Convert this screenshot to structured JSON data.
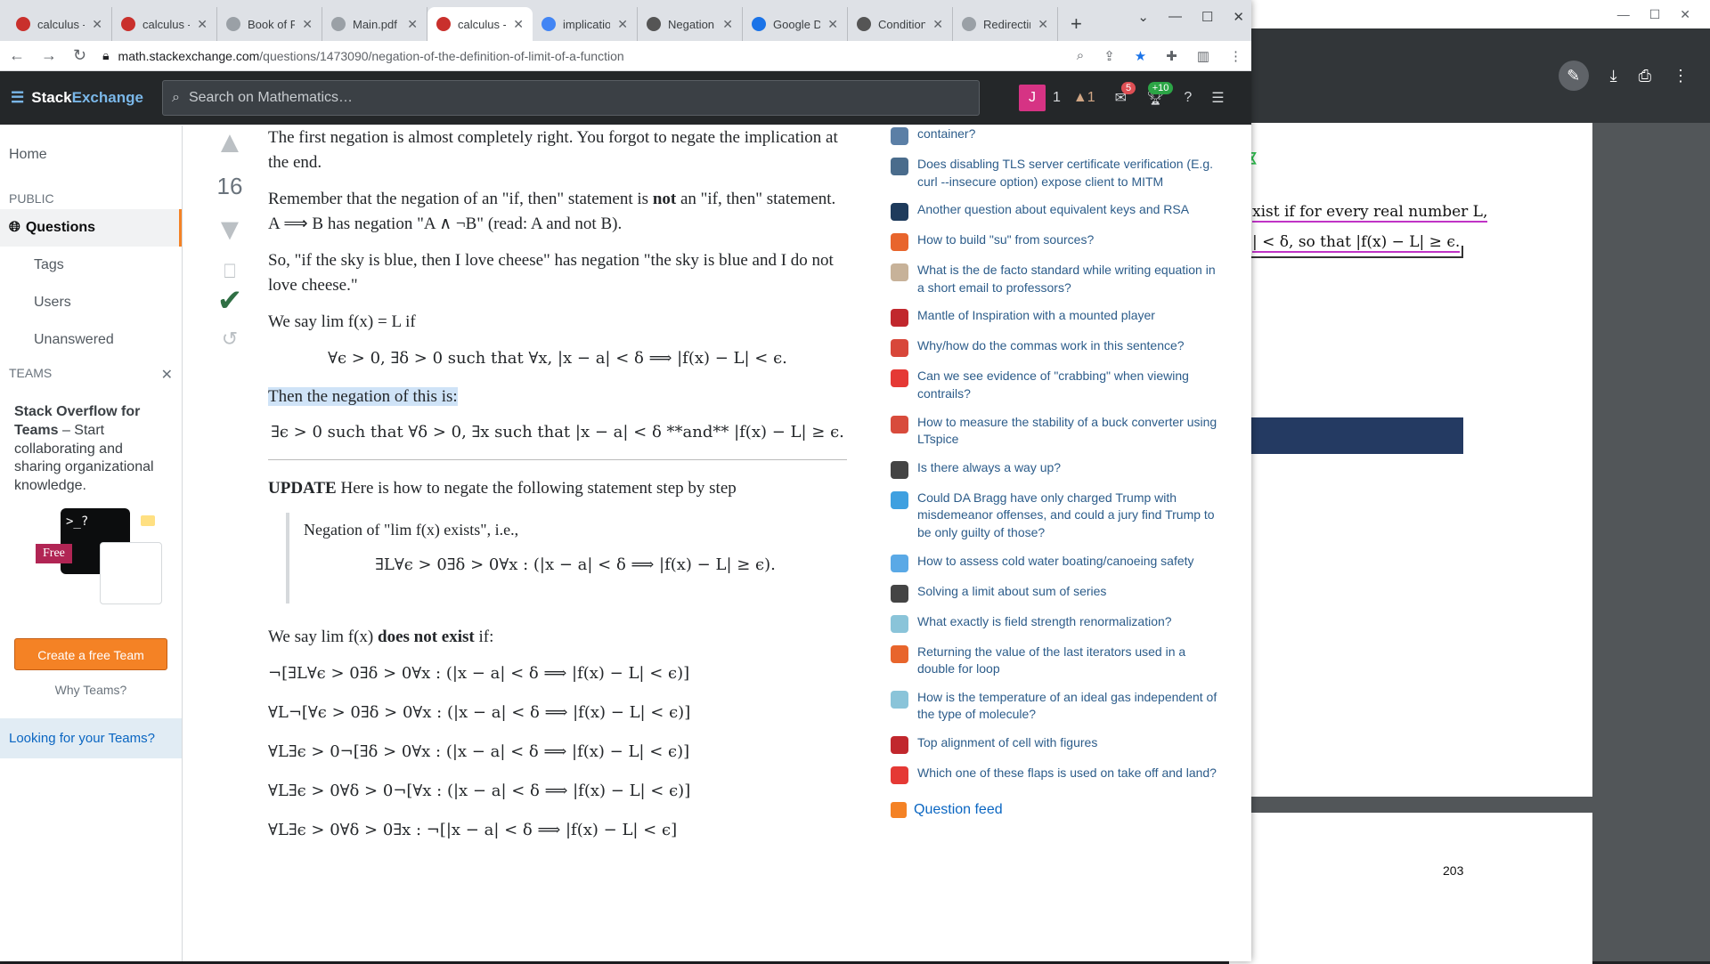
{
  "browser": {
    "tabs": [
      {
        "label": "calculus -",
        "fav": "#c9302c"
      },
      {
        "label": "calculus -",
        "fav": "#c9302c"
      },
      {
        "label": "Book of P",
        "fav": "#9aa0a6"
      },
      {
        "label": "Main.pdf",
        "fav": "#9aa0a6"
      },
      {
        "label": "calculus -",
        "fav": "#c9302c",
        "active": true
      },
      {
        "label": "implicatio",
        "fav": "#4285f4"
      },
      {
        "label": "Negation",
        "fav": "#555555"
      },
      {
        "label": "Google Da",
        "fav": "#1a73e8"
      },
      {
        "label": "Condition",
        "fav": "#555555"
      },
      {
        "label": "Redirectin",
        "fav": "#9aa0a6"
      }
    ],
    "url_host": "math.stackexchange.com",
    "url_path": "/questions/1473090/negation-of-the-definition-of-limit-of-a-function"
  },
  "se": {
    "logo_a": "Stack",
    "logo_b": "Exchange",
    "search_placeholder": "Search on Mathematics…",
    "avatar": "J",
    "rep": "1",
    "bronze": "1",
    "inbox": "5",
    "achv": "+10"
  },
  "nav": {
    "home": "Home",
    "public": "PUBLIC",
    "questions": "Questions",
    "tags": "Tags",
    "users": "Users",
    "unanswered": "Unanswered",
    "teams": "TEAMS",
    "team_title": "Stack Overflow for Teams",
    "team_desc": " – Start collaborating and sharing organizational knowledge.",
    "free": "Free",
    "create_btn": "Create a free Team",
    "why": "Why Teams?",
    "looking": "Looking for your Teams?"
  },
  "answer": {
    "score": "16",
    "p1": "The first negation is almost completely right. You forgot to negate the implication at the end.",
    "p2a": "Remember that the negation of an \"if, then\" statement is ",
    "p2b": "not",
    "p2c": " an \"if, then\" statement. A ⟹ B has negation \"A ∧ ¬B\" (read: A and not B).",
    "p3": "So, \"if the sky is blue, then I love cheese\" has negation \"the sky is blue and I do not love cheese.\"",
    "p4": "We say lim f(x) = L if",
    "m1": "∀ϵ > 0, ∃δ > 0 such that ∀x, |x − a| < δ ⟹ |f(x) − L| < ϵ.",
    "p5": "Then the negation of this is:",
    "m2": "∃ϵ > 0 such that ∀δ > 0, ∃x such that |x − a| < δ **and** |f(x) − L| ≥ ϵ.",
    "upd_b": "UPDATE",
    "upd": " Here is how to negate the following statement step by step",
    "q1": "Negation of \"lim f(x) exists\", i.e.,",
    "q2": "∃L∀ϵ > 0∃δ > 0∀x : (|x − a| < δ ⟹ |f(x) − L| ≥ ϵ).",
    "p6a": "We say lim f(x) ",
    "p6b": "does not exist",
    "p6c": " if:",
    "lines": [
      "¬[∃L∀ϵ > 0∃δ > 0∀x : (|x − a| < δ ⟹ |f(x) − L| < ϵ)]",
      "∀L¬[∀ϵ > 0∃δ > 0∀x : (|x − a| < δ ⟹ |f(x) − L| < ϵ)]",
      "∀L∃ϵ > 0¬[∃δ > 0∀x : (|x − a| < δ ⟹ |f(x) − L| < ϵ)]",
      "∀L∃ϵ > 0∀δ > 0¬[∀x : (|x − a| < δ ⟹ |f(x) − L| < ϵ)]",
      "∀L∃ϵ > 0∀δ > 0∃x : ¬[|x − a| < δ ⟹ |f(x) − L| < ϵ]"
    ]
  },
  "hot": [
    {
      "q": "container?",
      "c": "#5b7fa6"
    },
    {
      "q": "Does disabling TLS server certificate verification (E.g. curl --insecure option) expose client to MITM",
      "c": "#4a6c8c"
    },
    {
      "q": "Another question about equivalent keys and RSA",
      "c": "#1e3b5c"
    },
    {
      "q": "How to build \"su\" from sources?",
      "c": "#e8652c"
    },
    {
      "q": "What is the de facto standard while writing equation in a short email to professors?",
      "c": "#c7b299"
    },
    {
      "q": "Mantle of Inspiration with a mounted player",
      "c": "#c1272d"
    },
    {
      "q": "Why/how do the commas work in this sentence?",
      "c": "#d8473a"
    },
    {
      "q": "Can we see evidence of \"crabbing\" when viewing contrails?",
      "c": "#e53935"
    },
    {
      "q": "How to measure the stability of a buck converter using LTspice",
      "c": "#d84b3c"
    },
    {
      "q": "Is there always a way up?",
      "c": "#444444"
    },
    {
      "q": "Could DA Bragg have only charged Trump with misdemeanor offenses, and could a jury find Trump to be only guilty of those?",
      "c": "#3fa0e0"
    },
    {
      "q": "How to assess cold water boating/canoeing safety",
      "c": "#5aa9e6"
    },
    {
      "q": "Solving a limit about sum of series",
      "c": "#444444"
    },
    {
      "q": "What exactly is field strength renormalization?",
      "c": "#8ac4d9"
    },
    {
      "q": "Returning the value of the last iterators used in a double for loop",
      "c": "#e8652c"
    },
    {
      "q": "How is the temperature of an ideal gas independent of the type of molecule?",
      "c": "#8ac4d9"
    },
    {
      "q": "Top alignment of cell with figures",
      "c": "#c1272d"
    },
    {
      "q": "Which one of these flaps is used on take off and land?",
      "c": "#e53935"
    }
  ],
  "feed": "Question feed",
  "pdf": {
    "l1": "xist if for every real number L,",
    "l2": "| < δ,  so that |f(x) − L| ≥ ϵ.",
    "page": "203"
  }
}
